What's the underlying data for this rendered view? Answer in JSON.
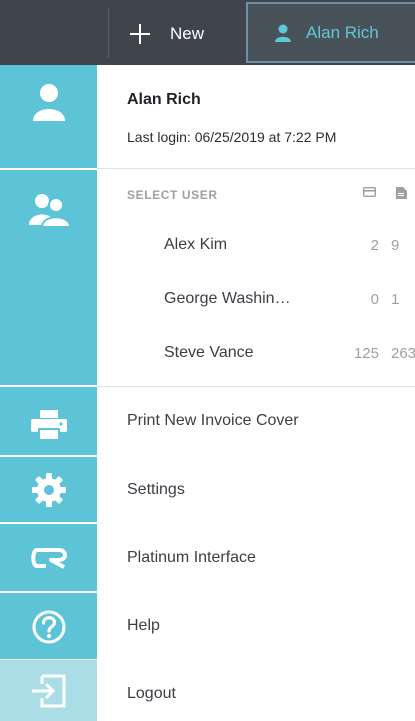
{
  "topbar": {
    "new_label": "New",
    "user_label": "Alan Rich"
  },
  "profile": {
    "name": "Alan Rich",
    "last_login": "Last login: 06/25/2019 at 7:22 PM"
  },
  "select_user": {
    "label": "SELECT USER",
    "users": [
      {
        "name": "Alex Kim",
        "count1": "2",
        "count2": "9"
      },
      {
        "name": "George Washin…",
        "count1": "0",
        "count2": "1"
      },
      {
        "name": "Steve Vance",
        "count1": "125",
        "count2": "263"
      }
    ]
  },
  "menu": {
    "print_invoice": "Print New Invoice Cover",
    "settings": "Settings",
    "platinum": "Platinum Interface",
    "help": "Help",
    "logout": "Logout"
  },
  "colors": {
    "rail": "#5cc4d6",
    "topbar": "#3f454b",
    "accent_text": "#5fc7d8"
  }
}
